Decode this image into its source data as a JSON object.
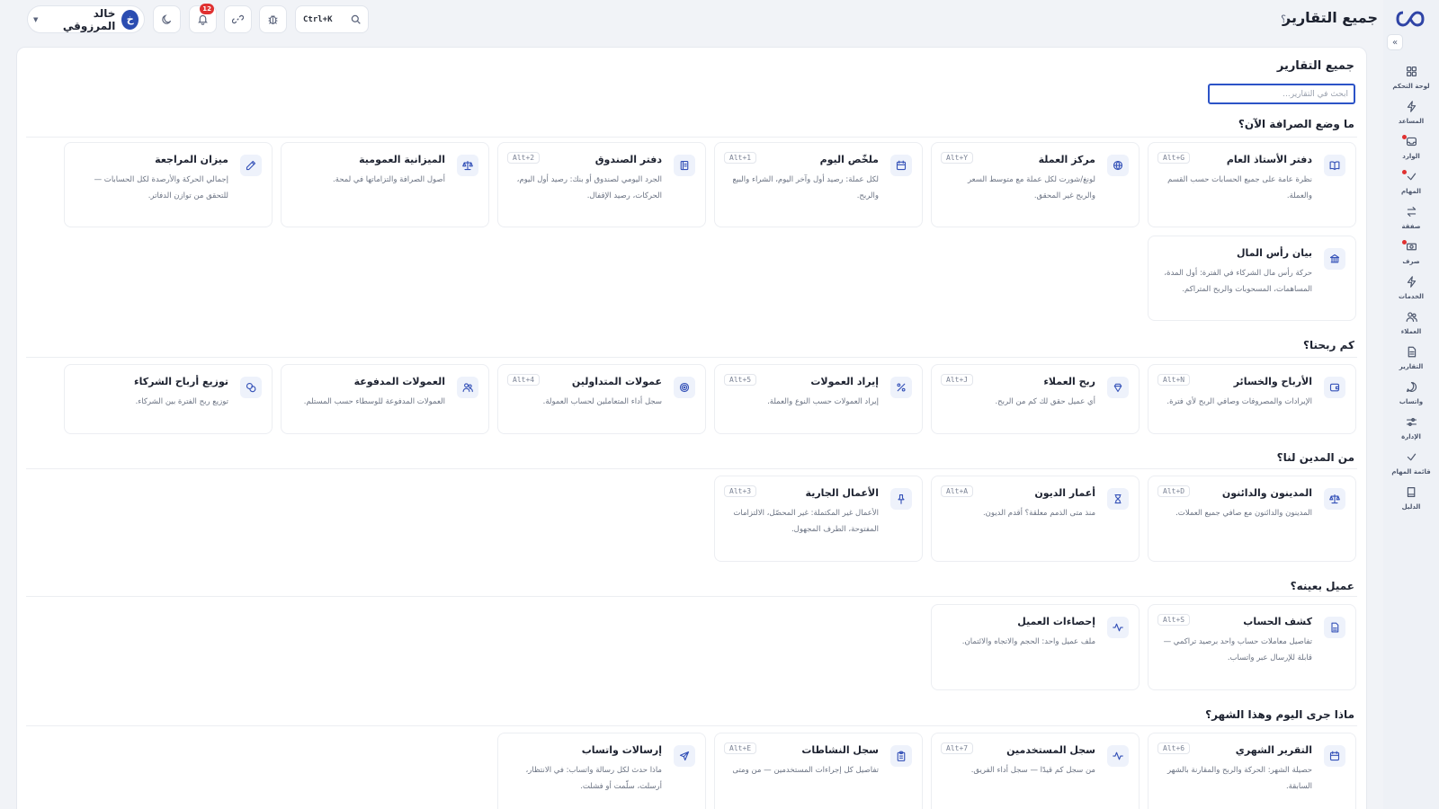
{
  "header": {
    "page_title": "جميع التقارير",
    "search_shortcut": "Ctrl+K",
    "notification_count": "12",
    "user": {
      "name": "خالد المرزوقي",
      "initial": "خ"
    }
  },
  "sidebar": {
    "items": [
      {
        "label": "لوحة التحكم",
        "icon": "dashboard-icon",
        "dot": false
      },
      {
        "label": "المساعد",
        "icon": "bolt-icon",
        "dot": false
      },
      {
        "label": "الوارد",
        "icon": "inbox-icon",
        "dot": true
      },
      {
        "label": "المهام",
        "icon": "check-icon",
        "dot": true
      },
      {
        "label": "صفقة",
        "icon": "exchange-icon",
        "dot": false
      },
      {
        "label": "صرف",
        "icon": "cash-icon",
        "dot": true
      },
      {
        "label": "الخدمات",
        "icon": "bolt-icon",
        "dot": false
      },
      {
        "label": "العملاء",
        "icon": "users-icon",
        "dot": false
      },
      {
        "label": "التقارير",
        "icon": "report-icon",
        "dot": false
      },
      {
        "label": "واتساب",
        "icon": "chat-icon",
        "dot": false
      },
      {
        "label": "الإدارة",
        "icon": "sliders-icon",
        "dot": false
      },
      {
        "label": "قائمة المهام",
        "icon": "check-icon",
        "dot": false
      },
      {
        "label": "الدليل",
        "icon": "book-icon",
        "dot": false
      }
    ]
  },
  "main": {
    "title": "جميع التقارير",
    "search_placeholder": "ابحث في التقارير...",
    "sections": [
      {
        "title": "ما وضع الصرافة الآن؟",
        "cards": [
          {
            "title": "دفتر الأستاذ العام",
            "desc": "نظرة عامة على جميع الحسابات حسب القسم والعملة.",
            "hotkey": "Alt+G",
            "icon": "book-open-icon"
          },
          {
            "title": "مركز العملة",
            "desc": "لونغ/شورت لكل عملة مع متوسط السعر والربح غير المحقق.",
            "hotkey": "Alt+Y",
            "icon": "globe-icon"
          },
          {
            "title": "ملخّص اليوم",
            "desc": "لكل عملة: رصيد أول وآخر اليوم، الشراء والبيع والربح.",
            "hotkey": "Alt+1",
            "icon": "calendar-icon"
          },
          {
            "title": "دفتر الصندوق",
            "desc": "الجرد اليومي لصندوق أو بنك: رصيد أول اليوم، الحركات، رصيد الإقفال.",
            "hotkey": "Alt+2",
            "icon": "ledger-icon"
          },
          {
            "title": "الميزانية العمومية",
            "desc": "أصول الصرافة والتزاماتها في لمحة.",
            "hotkey": "",
            "icon": "scale-icon"
          },
          {
            "title": "ميزان المراجعة",
            "desc": "إجمالي الحركة والأرصدة لكل الحسابات — للتحقق من توازن الدفاتر.",
            "hotkey": "",
            "icon": "pencil-icon"
          },
          {
            "title": "بيان رأس المال",
            "desc": "حركة رأس مال الشركاء في الفترة: أول المدة، المساهمات، المسحوبات والربح المتراكم.",
            "hotkey": "",
            "icon": "bank-icon"
          }
        ]
      },
      {
        "title": "كم ربحنا؟",
        "cards": [
          {
            "title": "الأرباح والخسائر",
            "desc": "الإيرادات والمصروفات وصافي الربح لأي فترة.",
            "hotkey": "Alt+N",
            "icon": "wallet-icon"
          },
          {
            "title": "ربح العملاء",
            "desc": "أي عميل حقق لك كم من الربح.",
            "hotkey": "Alt+J",
            "icon": "diamond-icon"
          },
          {
            "title": "إيراد العمولات",
            "desc": "إيراد العمولات حسب النوع والعملة.",
            "hotkey": "Alt+5",
            "icon": "percent-icon"
          },
          {
            "title": "عمولات المتداولين",
            "desc": "سجل أداء المتعاملين لحساب العمولة.",
            "hotkey": "Alt+4",
            "icon": "target-icon"
          },
          {
            "title": "العمولات المدفوعة",
            "desc": "العمولات المدفوعة للوسطاء حسب المستلم.",
            "hotkey": "",
            "icon": "users-icon"
          },
          {
            "title": "توزيع أرباح الشركاء",
            "desc": "توزيع ربح الفترة بين الشركاء.",
            "hotkey": "",
            "icon": "coins-icon"
          }
        ]
      },
      {
        "title": "من المدين لنا؟",
        "cards": [
          {
            "title": "المدينون والدائنون",
            "desc": "المدينون والدائنون مع صافي جميع العملات.",
            "hotkey": "Alt+D",
            "icon": "scale-icon"
          },
          {
            "title": "أعمار الديون",
            "desc": "منذ متى الذمم معلقة؟ أقدم الديون.",
            "hotkey": "Alt+A",
            "icon": "hourglass-icon"
          },
          {
            "title": "الأعمال الجارية",
            "desc": "الأعمال غير المكتملة: غير المحصّل، الالتزامات المفتوحة، الطرف المجهول.",
            "hotkey": "Alt+3",
            "icon": "pin-icon"
          }
        ]
      },
      {
        "title": "عميل بعينه؟",
        "cards": [
          {
            "title": "كشف الحساب",
            "desc": "تفاصيل معاملات حساب واحد برصيد تراكمي — قابلة للإرسال عبر واتساب.",
            "hotkey": "Alt+S",
            "icon": "file-icon"
          },
          {
            "title": "إحصاءات العميل",
            "desc": "ملف عميل واحد: الحجم والاتجاه والائتمان.",
            "hotkey": "",
            "icon": "activity-icon"
          }
        ]
      },
      {
        "title": "ماذا جرى اليوم وهذا الشهر؟",
        "cards": [
          {
            "title": "التقرير الشهري",
            "desc": "حصيلة الشهر: الحركة والربح والمقارنة بالشهر السابقة.",
            "hotkey": "Alt+6",
            "icon": "calendar-icon"
          },
          {
            "title": "سجل المستخدمين",
            "desc": "من سجل كم قيدًا — سجل أداء الفريق.",
            "hotkey": "Alt+7",
            "icon": "activity-icon"
          },
          {
            "title": "سجل النشاطات",
            "desc": "تفاصيل كل إجراءات المستخدمين — من ومتى",
            "hotkey": "Alt+E",
            "icon": "clipboard-icon"
          },
          {
            "title": "إرسالات واتساب",
            "desc": "ماذا حدث لكل رسالة واتساب: في الانتظار، أرسلت، سلّمت أو فشلت.",
            "hotkey": "",
            "icon": "send-icon"
          }
        ]
      }
    ]
  }
}
